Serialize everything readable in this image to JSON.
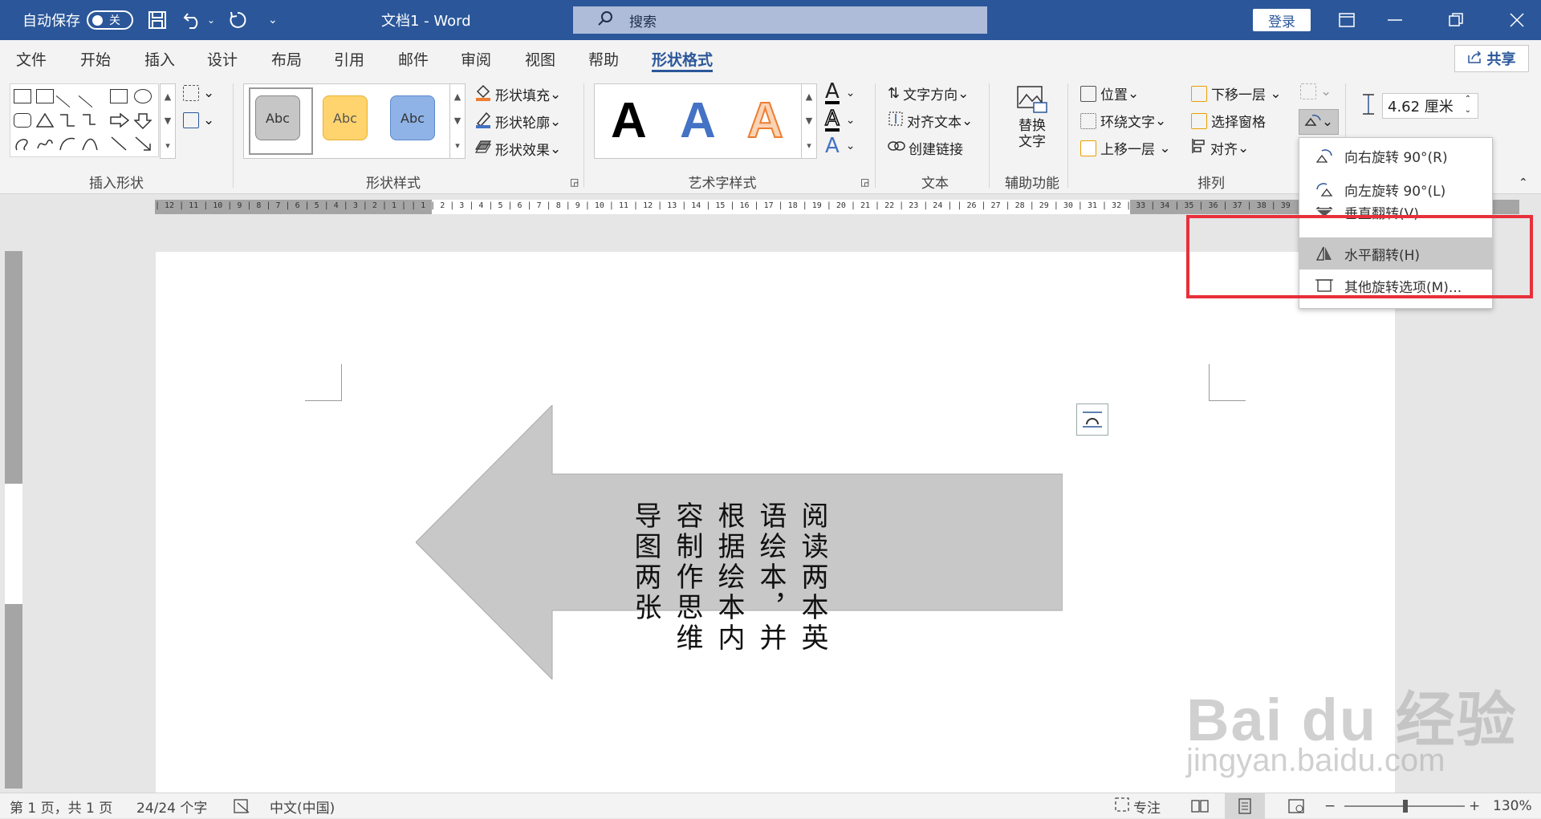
{
  "titlebar": {
    "autosave_label": "自动保存",
    "autosave_state": "关",
    "doc_title": "文档1  -  Word",
    "search_placeholder": "搜索",
    "login": "登录"
  },
  "tabs": [
    "文件",
    "开始",
    "插入",
    "设计",
    "布局",
    "引用",
    "邮件",
    "审阅",
    "视图",
    "帮助",
    "形状格式"
  ],
  "active_tab": "形状格式",
  "share_label": "共享",
  "ribbon": {
    "groups": {
      "insert_shapes": "插入形状",
      "shape_styles": "形状样式",
      "wordart_styles": "艺术字样式",
      "text": "文本",
      "accessibility": "辅助功能",
      "arrange": "排列"
    },
    "style_swatch_label": "Abc",
    "wordart_letter": "A",
    "shape_fill": "形状填充",
    "shape_outline": "形状轮廓",
    "shape_effects": "形状效果",
    "text_direction": "文字方向",
    "align_text": "对齐文本",
    "create_link": "创建链接",
    "alt_text_line1": "替换",
    "alt_text_line2": "文字",
    "position": "位置",
    "wrap_text": "环绕文字",
    "bring_forward": "上移一层",
    "send_backward": "下移一层",
    "selection_pane": "选择窗格",
    "align": "对齐",
    "size_value": "4.62 厘米"
  },
  "ruler_numbers": "| 12 | 11 | 10 | 9 | 8 | 7 | 6 | 5 | 4 | 3 | 2 | 1 |  | 1 | 2 | 3 | 4 | 5 | 6 | 7 | 8 | 9 | 10 | 11 | 12 | 13 | 14 | 15 | 16 | 17 | 18 | 19 | 20 | 21 | 22 | 23 | 24 |  | 26 | 27 | 28 | 29 | 30 | 31 | 32 | 33 | 34 | 35 | 36 | 37 | 38 | 39",
  "arrow_text": "阅读两本英语绘本，并根据绘本内容制作思维导图两张",
  "rotate_menu": [
    {
      "label": "向右旋转 90°(R)",
      "icon": "rotate-right-icon"
    },
    {
      "label": "向左旋转 90°(L)",
      "icon": "rotate-left-icon"
    },
    {
      "label": "垂直翻转(V)",
      "icon": "flip-vertical-icon"
    },
    {
      "label": "水平翻转(H)",
      "icon": "flip-horizontal-icon"
    },
    {
      "label": "其他旋转选项(M)...",
      "icon": "more-rotation-icon"
    }
  ],
  "status": {
    "page": "第 1 页，共 1 页",
    "words": "24/24 个字",
    "language": "中文(中国)",
    "focus": "专注",
    "zoom": "130%"
  },
  "watermark": {
    "brand": "Bai du 经验",
    "url": "jingyan.baidu.com"
  },
  "colors": {
    "accent": "#2b579a",
    "highlight_box": "#e8303a",
    "arrow_fill": "#c8c8c8"
  }
}
